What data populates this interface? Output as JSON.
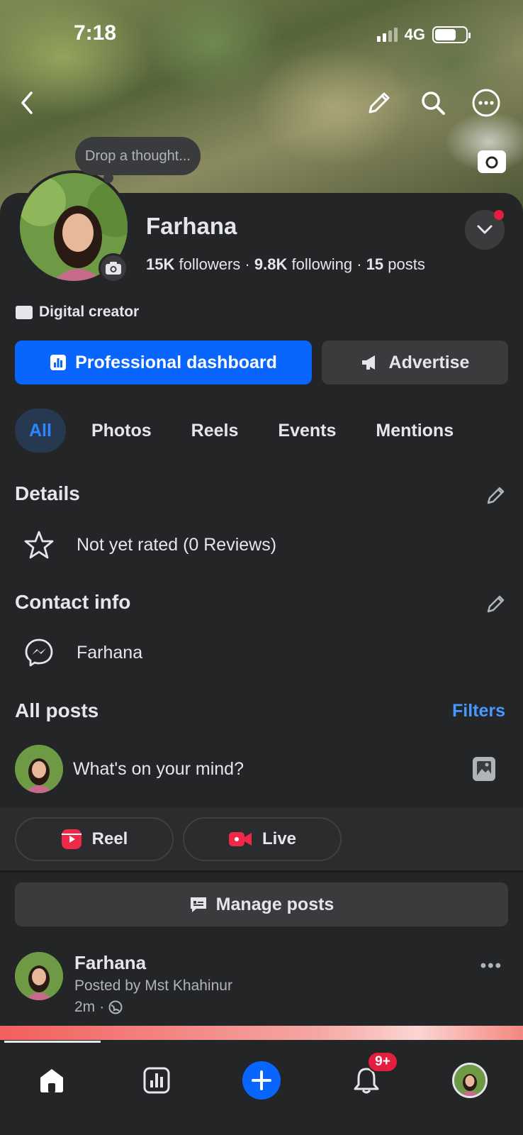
{
  "status_bar": {
    "time": "7:18",
    "network": "4G"
  },
  "cover": {
    "thought_prompt": "Drop a thought..."
  },
  "profile": {
    "name": "Farhana",
    "followers_count": "15K",
    "followers_label": "followers",
    "following_count": "9.8K",
    "following_label": "following",
    "posts_count": "15",
    "posts_label": "posts",
    "category": "Digital creator"
  },
  "actions": {
    "primary_label": "Professional dashboard",
    "secondary_label": "Advertise"
  },
  "tabs": [
    {
      "label": "All",
      "active": true
    },
    {
      "label": "Photos",
      "active": false
    },
    {
      "label": "Reels",
      "active": false
    },
    {
      "label": "Events",
      "active": false
    },
    {
      "label": "Mentions",
      "active": false
    }
  ],
  "details": {
    "title": "Details",
    "rating_text": "Not yet rated (0 Reviews)"
  },
  "contact": {
    "title": "Contact info",
    "messenger_name": "Farhana"
  },
  "posts_section": {
    "title": "All posts",
    "filters_label": "Filters",
    "composer_placeholder": "What's on your mind?",
    "reel_label": "Reel",
    "live_label": "Live",
    "manage_label": "Manage posts"
  },
  "post": {
    "author": "Farhana",
    "posted_by": "Posted by Mst Khahinur",
    "time": "2m"
  },
  "bottom_nav": {
    "notifications_badge": "9+"
  },
  "colors": {
    "accent": "#0866ff",
    "link": "#4599ff",
    "background": "#242526",
    "button_gray": "#3a3b3c",
    "badge_red": "#e41e3f"
  }
}
